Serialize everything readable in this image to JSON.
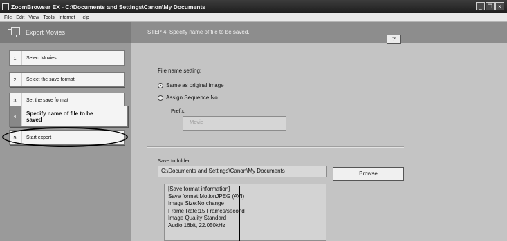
{
  "window": {
    "title": "ZoomBrowser EX  -  C:\\Documents and Settings\\Canon\\My Documents",
    "min_glyph": "_",
    "max_glyph": "❐",
    "close_glyph": "×"
  },
  "menu": [
    "File",
    "Edit",
    "View",
    "Tools",
    "Internet",
    "Help"
  ],
  "sidebar": {
    "header": "Export Movies",
    "steps": [
      {
        "num": "1.",
        "label": "Select Movies"
      },
      {
        "num": "2.",
        "label": "Select the save format"
      },
      {
        "num": "3.",
        "label": "Set the save format"
      },
      {
        "num": "4.",
        "label": "Specify name of file to be saved"
      },
      {
        "num": "5.",
        "label": "Start export"
      }
    ]
  },
  "main": {
    "step_title": "STEP 4: Specify name of file to be saved.",
    "help_label": "?",
    "file_name_setting": {
      "heading": "File name setting:",
      "options": [
        {
          "label": "Same as original image",
          "selected": true
        },
        {
          "label": "Assign Sequence No.",
          "selected": false
        }
      ],
      "prefix_label": "Prefix:",
      "prefix_value": "Movie"
    },
    "save_to": {
      "label": "Save to folder:",
      "path": "C:\\Documents and Settings\\Canon\\My Documents",
      "browse_label": "Browse"
    },
    "info": [
      "[Save format information]",
      "Save format:MotionJPEG (AVI)",
      "Image Size:No change",
      "Frame Rate:15 Frames/second",
      "Image Quality:Standard",
      "Audio:16bit, 22.050kHz"
    ]
  }
}
